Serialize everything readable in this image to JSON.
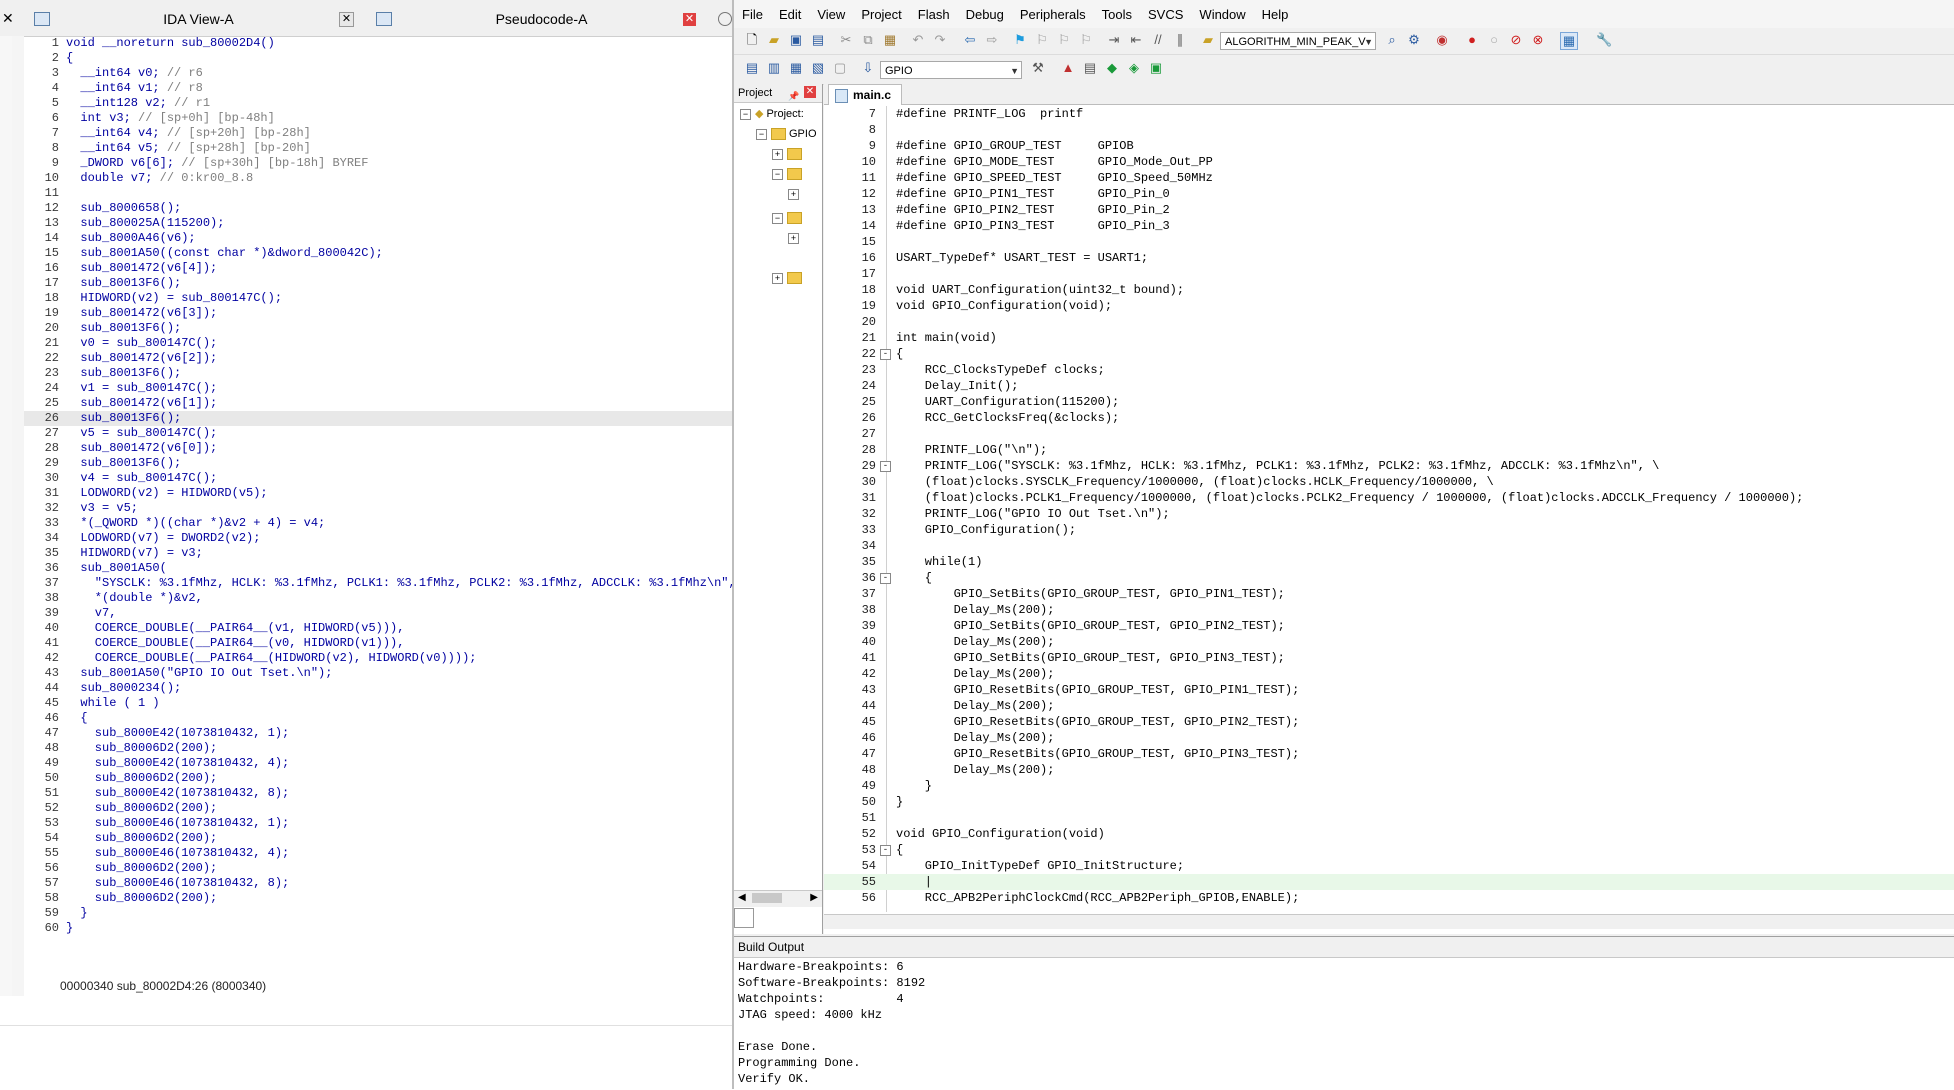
{
  "ida": {
    "tabs": [
      {
        "label": "IDA View-A",
        "close": "✕"
      },
      {
        "label": "Pseudocode-A",
        "close": "✕"
      }
    ],
    "lines": [
      {
        "n": "1",
        "t": "void __noreturn sub_80002D4()",
        "bp": false
      },
      {
        "n": "2",
        "t": "{",
        "bp": false
      },
      {
        "n": "3",
        "t": "  __int64 v0; // r6",
        "bp": false
      },
      {
        "n": "4",
        "t": "  __int64 v1; // r8",
        "bp": false
      },
      {
        "n": "5",
        "t": "  __int128 v2; // r1",
        "bp": false
      },
      {
        "n": "6",
        "t": "  int v3; // [sp+0h] [bp-48h]",
        "bp": false
      },
      {
        "n": "7",
        "t": "  __int64 v4; // [sp+20h] [bp-28h]",
        "bp": false
      },
      {
        "n": "8",
        "t": "  __int64 v5; // [sp+28h] [bp-20h]",
        "bp": false
      },
      {
        "n": "9",
        "t": "  _DWORD v6[6]; // [sp+30h] [bp-18h] BYREF",
        "bp": false
      },
      {
        "n": "10",
        "t": "  double v7; // 0:kr00_8.8",
        "bp": false
      },
      {
        "n": "11",
        "t": "",
        "bp": false
      },
      {
        "n": "12",
        "t": "  sub_8000658();",
        "bp": true
      },
      {
        "n": "13",
        "t": "  sub_800025A(115200);",
        "bp": true
      },
      {
        "n": "14",
        "t": "  sub_8000A46(v6);",
        "bp": true
      },
      {
        "n": "15",
        "t": "  sub_8001A50((const char *)&dword_800042C);",
        "bp": true
      },
      {
        "n": "16",
        "t": "  sub_8001472(v6[4]);",
        "bp": true
      },
      {
        "n": "17",
        "t": "  sub_80013F6();",
        "bp": true
      },
      {
        "n": "18",
        "t": "  HIDWORD(v2) = sub_800147C();",
        "bp": true
      },
      {
        "n": "19",
        "t": "  sub_8001472(v6[3]);",
        "bp": true
      },
      {
        "n": "20",
        "t": "  sub_80013F6();",
        "bp": true
      },
      {
        "n": "21",
        "t": "  v0 = sub_800147C();",
        "bp": true
      },
      {
        "n": "22",
        "t": "  sub_8001472(v6[2]);",
        "bp": true
      },
      {
        "n": "23",
        "t": "  sub_80013F6();",
        "bp": true
      },
      {
        "n": "24",
        "t": "  v1 = sub_800147C();",
        "bp": true
      },
      {
        "n": "25",
        "t": "  sub_8001472(v6[1]);",
        "bp": true
      },
      {
        "n": "26",
        "t": "  sub_80013F6();",
        "bp": true
      },
      {
        "n": "27",
        "t": "  v5 = sub_800147C();",
        "bp": true
      },
      {
        "n": "28",
        "t": "  sub_8001472(v6[0]);",
        "bp": true
      },
      {
        "n": "29",
        "t": "  sub_80013F6();",
        "bp": true
      },
      {
        "n": "30",
        "t": "  v4 = sub_800147C();",
        "bp": true
      },
      {
        "n": "31",
        "t": "  LODWORD(v2) = HIDWORD(v5);",
        "bp": true
      },
      {
        "n": "32",
        "t": "  v3 = v5;",
        "bp": true
      },
      {
        "n": "33",
        "t": "  *(_QWORD *)((char *)&v2 + 4) = v4;",
        "bp": true
      },
      {
        "n": "34",
        "t": "  LODWORD(v7) = DWORD2(v2);",
        "bp": true
      },
      {
        "n": "35",
        "t": "  HIDWORD(v7) = v3;",
        "bp": true
      },
      {
        "n": "36",
        "t": "  sub_8001A50(",
        "bp": true
      },
      {
        "n": "37",
        "t": "    \"SYSCLK: %3.1fMhz, HCLK: %3.1fMhz, PCLK1: %3.1fMhz, PCLK2: %3.1fMhz, ADCCLK: %3.1fMhz\\n\",",
        "bp": false
      },
      {
        "n": "38",
        "t": "    *(double *)&v2,",
        "bp": false
      },
      {
        "n": "39",
        "t": "    v7,",
        "bp": false
      },
      {
        "n": "40",
        "t": "    COERCE_DOUBLE(__PAIR64__(v1, HIDWORD(v5))),",
        "bp": false
      },
      {
        "n": "41",
        "t": "    COERCE_DOUBLE(__PAIR64__(v0, HIDWORD(v1))),",
        "bp": false
      },
      {
        "n": "42",
        "t": "    COERCE_DOUBLE(__PAIR64__(HIDWORD(v2), HIDWORD(v0))));",
        "bp": false
      },
      {
        "n": "43",
        "t": "  sub_8001A50(\"GPIO IO Out Tset.\\n\");",
        "bp": true
      },
      {
        "n": "44",
        "t": "  sub_8000234();",
        "bp": true
      },
      {
        "n": "45",
        "t": "  while ( 1 )",
        "bp": true
      },
      {
        "n": "46",
        "t": "  {",
        "bp": false
      },
      {
        "n": "47",
        "t": "    sub_8000E42(1073810432, 1);",
        "bp": true
      },
      {
        "n": "48",
        "t": "    sub_80006D2(200);",
        "bp": true
      },
      {
        "n": "49",
        "t": "    sub_8000E42(1073810432, 4);",
        "bp": true
      },
      {
        "n": "50",
        "t": "    sub_80006D2(200);",
        "bp": true
      },
      {
        "n": "51",
        "t": "    sub_8000E42(1073810432, 8);",
        "bp": true
      },
      {
        "n": "52",
        "t": "    sub_80006D2(200);",
        "bp": true
      },
      {
        "n": "53",
        "t": "    sub_8000E46(1073810432, 1);",
        "bp": true
      },
      {
        "n": "54",
        "t": "    sub_80006D2(200);",
        "bp": true
      },
      {
        "n": "55",
        "t": "    sub_8000E46(1073810432, 4);",
        "bp": true
      },
      {
        "n": "56",
        "t": "    sub_80006D2(200);",
        "bp": true
      },
      {
        "n": "57",
        "t": "    sub_8000E46(1073810432, 8);",
        "bp": true
      },
      {
        "n": "58",
        "t": "    sub_80006D2(200);",
        "bp": true
      },
      {
        "n": "59",
        "t": "  }",
        "bp": true
      },
      {
        "n": "60",
        "t": "}",
        "bp": true
      }
    ],
    "highlight_line": "26",
    "status": "00000340 sub_80002D4:26 (8000340)"
  },
  "keil": {
    "menu": [
      "File",
      "Edit",
      "View",
      "Project",
      "Flash",
      "Debug",
      "Peripherals",
      "Tools",
      "SVCS",
      "Window",
      "Help"
    ],
    "target_combo": "ALGORITHM_MIN_PEAK_V",
    "project_combo": "GPIO",
    "project_panel": {
      "title": "Project",
      "root": "Project:",
      "target": "GPIO"
    },
    "editor_tab": "main.c",
    "code": [
      {
        "n": "7",
        "t": "#define PRINTF_LOG  printf",
        "f": ""
      },
      {
        "n": "8",
        "t": "",
        "f": ""
      },
      {
        "n": "9",
        "t": "#define GPIO_GROUP_TEST     GPIOB",
        "f": ""
      },
      {
        "n": "10",
        "t": "#define GPIO_MODE_TEST      GPIO_Mode_Out_PP",
        "f": ""
      },
      {
        "n": "11",
        "t": "#define GPIO_SPEED_TEST     GPIO_Speed_50MHz",
        "f": ""
      },
      {
        "n": "12",
        "t": "#define GPIO_PIN1_TEST      GPIO_Pin_0",
        "f": ""
      },
      {
        "n": "13",
        "t": "#define GPIO_PIN2_TEST      GPIO_Pin_2",
        "f": ""
      },
      {
        "n": "14",
        "t": "#define GPIO_PIN3_TEST      GPIO_Pin_3",
        "f": ""
      },
      {
        "n": "15",
        "t": "",
        "f": ""
      },
      {
        "n": "16",
        "t": "USART_TypeDef* USART_TEST = USART1;",
        "f": ""
      },
      {
        "n": "17",
        "t": "",
        "f": ""
      },
      {
        "n": "18",
        "t": "void UART_Configuration(uint32_t bound);",
        "f": ""
      },
      {
        "n": "19",
        "t": "void GPIO_Configuration(void);",
        "f": ""
      },
      {
        "n": "20",
        "t": "",
        "f": ""
      },
      {
        "n": "21",
        "t": "int main(void)",
        "f": ""
      },
      {
        "n": "22",
        "t": "{",
        "f": "-"
      },
      {
        "n": "23",
        "t": "    RCC_ClocksTypeDef clocks;",
        "f": ""
      },
      {
        "n": "24",
        "t": "    Delay_Init();",
        "f": ""
      },
      {
        "n": "25",
        "t": "    UART_Configuration(115200);",
        "f": ""
      },
      {
        "n": "26",
        "t": "    RCC_GetClocksFreq(&clocks);",
        "f": ""
      },
      {
        "n": "27",
        "t": "",
        "f": ""
      },
      {
        "n": "28",
        "t": "    PRINTF_LOG(\"\\n\");",
        "f": ""
      },
      {
        "n": "29",
        "t": "    PRINTF_LOG(\"SYSCLK: %3.1fMhz, HCLK: %3.1fMhz, PCLK1: %3.1fMhz, PCLK2: %3.1fMhz, ADCCLK: %3.1fMhz\\n\", \\",
        "f": "-"
      },
      {
        "n": "30",
        "t": "    (float)clocks.SYSCLK_Frequency/1000000, (float)clocks.HCLK_Frequency/1000000, \\",
        "f": ""
      },
      {
        "n": "31",
        "t": "    (float)clocks.PCLK1_Frequency/1000000, (float)clocks.PCLK2_Frequency / 1000000, (float)clocks.ADCCLK_Frequency / 1000000);",
        "f": ""
      },
      {
        "n": "32",
        "t": "    PRINTF_LOG(\"GPIO IO Out Tset.\\n\");",
        "f": ""
      },
      {
        "n": "33",
        "t": "    GPIO_Configuration();",
        "f": ""
      },
      {
        "n": "34",
        "t": "",
        "f": ""
      },
      {
        "n": "35",
        "t": "    while(1)",
        "f": ""
      },
      {
        "n": "36",
        "t": "    {",
        "f": "-"
      },
      {
        "n": "37",
        "t": "        GPIO_SetBits(GPIO_GROUP_TEST, GPIO_PIN1_TEST);",
        "f": ""
      },
      {
        "n": "38",
        "t": "        Delay_Ms(200);",
        "f": ""
      },
      {
        "n": "39",
        "t": "        GPIO_SetBits(GPIO_GROUP_TEST, GPIO_PIN2_TEST);",
        "f": ""
      },
      {
        "n": "40",
        "t": "        Delay_Ms(200);",
        "f": ""
      },
      {
        "n": "41",
        "t": "        GPIO_SetBits(GPIO_GROUP_TEST, GPIO_PIN3_TEST);",
        "f": ""
      },
      {
        "n": "42",
        "t": "        Delay_Ms(200);",
        "f": ""
      },
      {
        "n": "43",
        "t": "        GPIO_ResetBits(GPIO_GROUP_TEST, GPIO_PIN1_TEST);",
        "f": ""
      },
      {
        "n": "44",
        "t": "        Delay_Ms(200);",
        "f": ""
      },
      {
        "n": "45",
        "t": "        GPIO_ResetBits(GPIO_GROUP_TEST, GPIO_PIN2_TEST);",
        "f": ""
      },
      {
        "n": "46",
        "t": "        Delay_Ms(200);",
        "f": ""
      },
      {
        "n": "47",
        "t": "        GPIO_ResetBits(GPIO_GROUP_TEST, GPIO_PIN3_TEST);",
        "f": ""
      },
      {
        "n": "48",
        "t": "        Delay_Ms(200);",
        "f": ""
      },
      {
        "n": "49",
        "t": "    }",
        "f": ""
      },
      {
        "n": "50",
        "t": "}",
        "f": ""
      },
      {
        "n": "51",
        "t": "",
        "f": ""
      },
      {
        "n": "52",
        "t": "void GPIO_Configuration(void)",
        "f": ""
      },
      {
        "n": "53",
        "t": "{",
        "f": "-"
      },
      {
        "n": "54",
        "t": "    GPIO_InitTypeDef GPIO_InitStructure;",
        "f": ""
      },
      {
        "n": "55",
        "t": "    |",
        "f": ""
      },
      {
        "n": "56",
        "t": "    RCC_APB2PeriphClockCmd(RCC_APB2Periph_GPIOB,ENABLE);",
        "f": ""
      }
    ],
    "current_line": "55",
    "build": {
      "title": "Build Output",
      "lines": [
        "Hardware-Breakpoints: 6",
        "Software-Breakpoints: 8192",
        "Watchpoints:          4",
        "JTAG speed: 4000 kHz",
        "",
        "Erase Done.",
        "Programming Done.",
        "Verify OK."
      ]
    }
  }
}
